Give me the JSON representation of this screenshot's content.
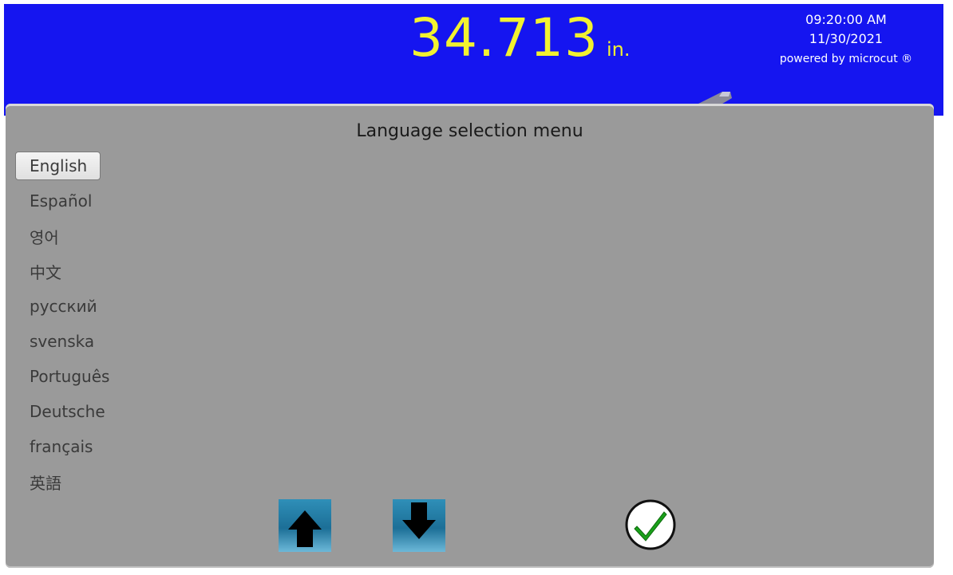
{
  "header": {
    "measurement_value": "34.713",
    "measurement_unit": "in.",
    "time": "09:20:00 AM",
    "date": "11/30/2021",
    "brand": "powered by microcut ®"
  },
  "menu": {
    "title": "Language selection menu",
    "selected_index": 0,
    "languages": [
      {
        "label": "English"
      },
      {
        "label": "Español"
      },
      {
        "label": "영어"
      },
      {
        "label": "中文"
      },
      {
        "label": "русский"
      },
      {
        "label": "svenska"
      },
      {
        "label": "Português"
      },
      {
        "label": "Deutsche"
      },
      {
        "label": "français"
      },
      {
        "label": "英語"
      }
    ]
  },
  "controls": {
    "up_icon": "arrow-up-icon",
    "down_icon": "arrow-down-icon",
    "confirm_icon": "checkmark-icon"
  },
  "colors": {
    "header_background": "#1515f0",
    "measurement": "#f2f230",
    "panel_background": "#9a9a9a",
    "confirm_check": "#1aa01a"
  }
}
